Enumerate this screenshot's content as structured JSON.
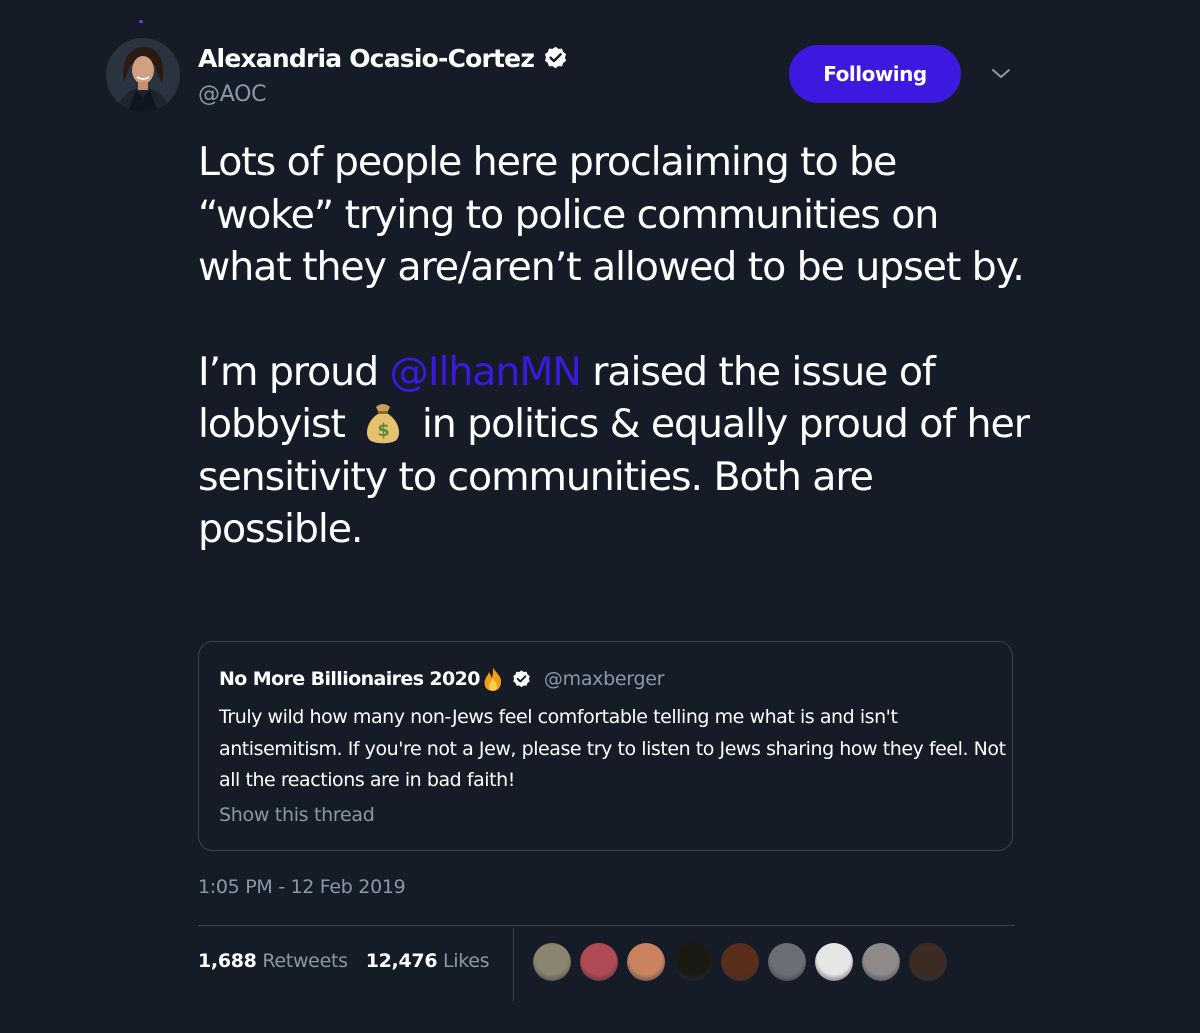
{
  "author": {
    "display_name": "Alexandria Ocasio-Cortez",
    "handle": "@AOC",
    "verified_icon": "verified-badge-icon"
  },
  "follow_button": {
    "label": "Following",
    "color": "#3d19e0"
  },
  "menu": {
    "icon": "chevron-down-icon"
  },
  "tweet": {
    "paragraph1": "Lots of people here proclaiming to be “woke” trying to police communities on what they are/aren’t allowed to be upset by.",
    "p2_before": "I’m proud ",
    "mention": "@IlhanMN",
    "p2_mid": " raised the issue of lobbyist ",
    "emoji": "money-bag-icon",
    "p2_after": " in politics & equally proud of her sensitivity to communities. Both are possible."
  },
  "quoted_tweet": {
    "display_name": "No More Billionaires 2020",
    "emoji": "fire-icon",
    "verified_icon": "verified-badge-icon",
    "handle": "@maxberger",
    "text": "Truly wild how many non-Jews feel comfortable telling me what is and isn't antisemitism. If you're not a Jew, please try to listen to Jews sharing how they feel. Not all the reactions are in bad faith!",
    "show_thread": "Show this thread"
  },
  "timestamp": "1:05 PM - 12 Feb 2019",
  "stats": {
    "retweets_count": "1,688",
    "retweets_label": "Retweets",
    "likes_count": "12,476",
    "likes_label": "Likes"
  },
  "likers": [
    {
      "name": "liker-avatar-1",
      "color": "#8a8470"
    },
    {
      "name": "liker-avatar-2",
      "color": "#b04a55"
    },
    {
      "name": "liker-avatar-3",
      "color": "#c9835f"
    },
    {
      "name": "liker-avatar-4",
      "color": "#1a1a12"
    },
    {
      "name": "liker-avatar-5",
      "color": "#5a2d1a"
    },
    {
      "name": "liker-avatar-6",
      "color": "#6b6f74"
    },
    {
      "name": "liker-avatar-7",
      "color": "#e6e6e6"
    },
    {
      "name": "liker-avatar-8",
      "color": "#8f8a8a"
    },
    {
      "name": "liker-avatar-9",
      "color": "#3b2b22"
    }
  ],
  "colors": {
    "background": "#151c27",
    "link": "#3d19e0",
    "secondary_text": "#8899a6",
    "border": "#38444d"
  }
}
